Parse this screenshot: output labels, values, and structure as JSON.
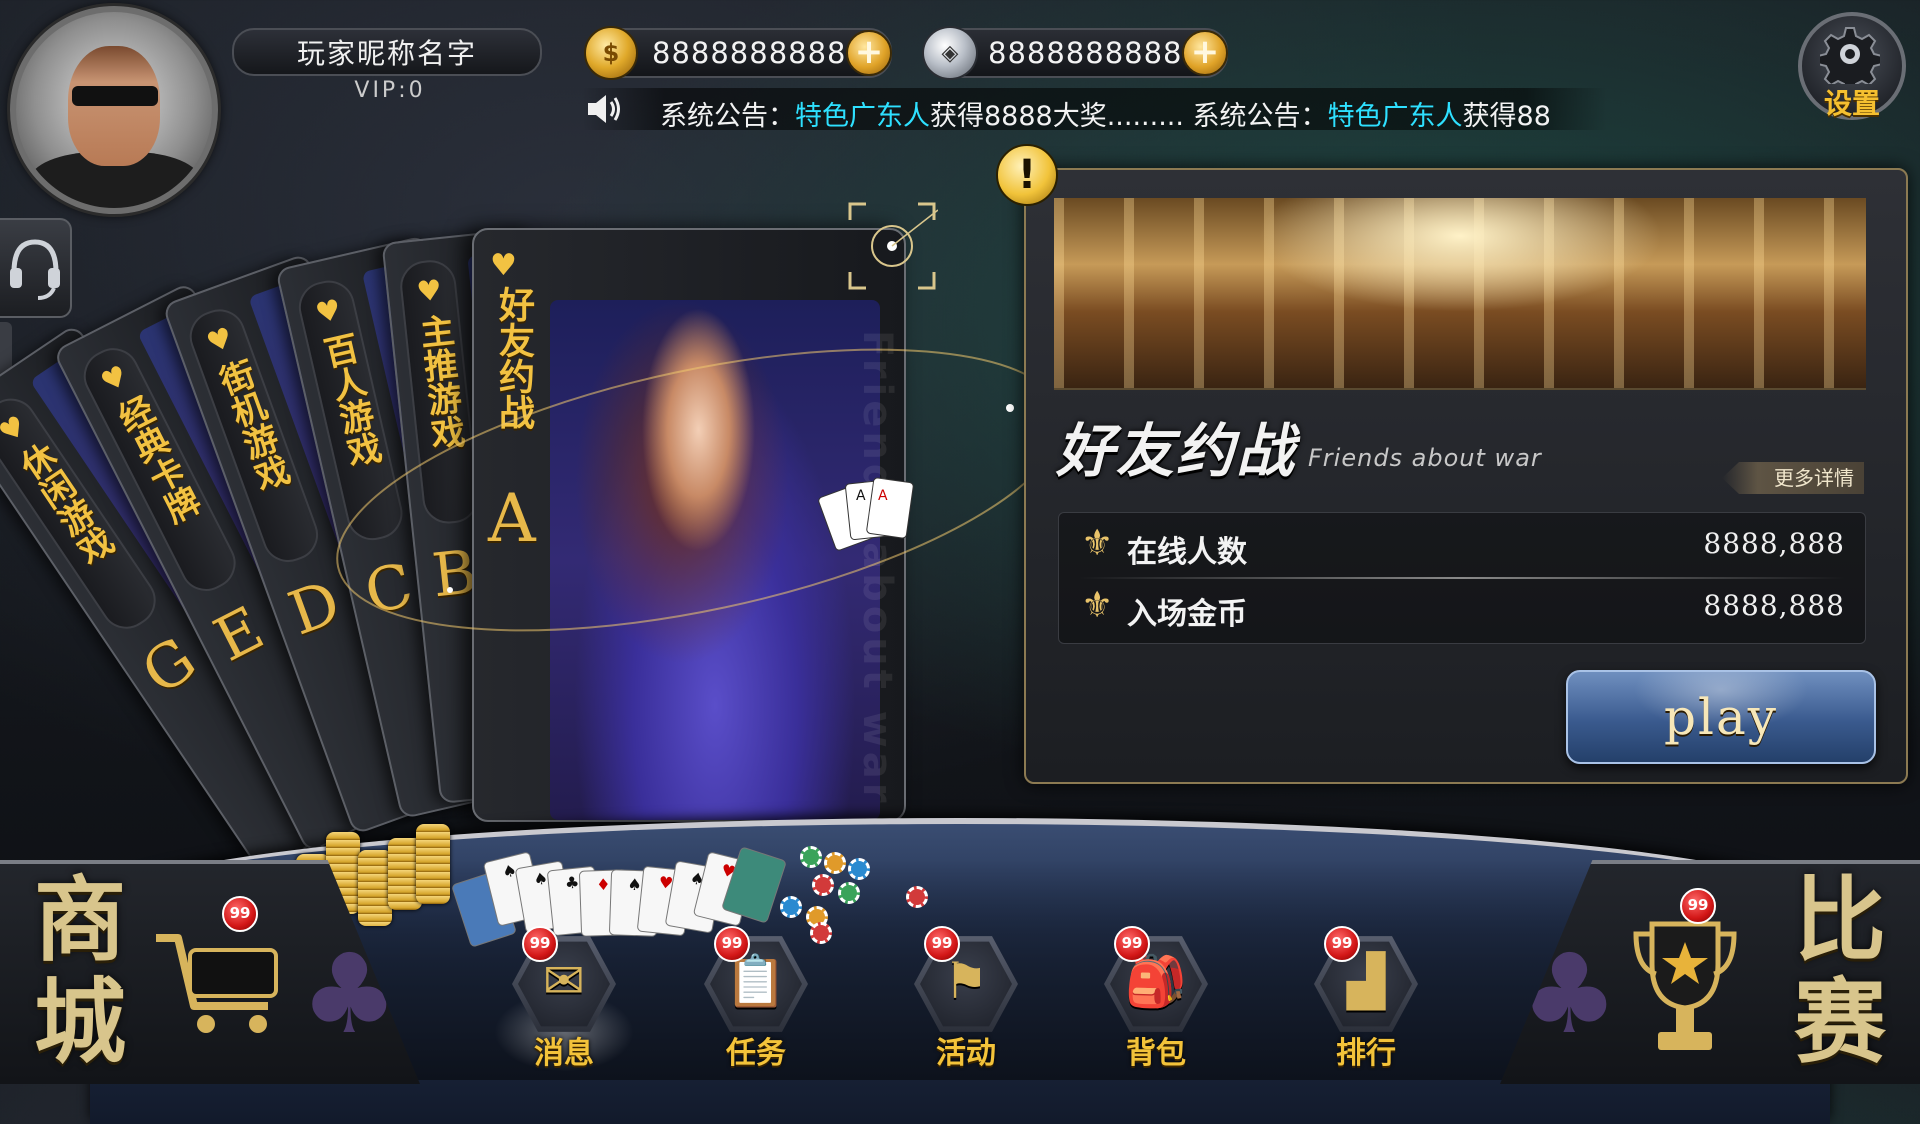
{
  "player": {
    "nickname": "玩家昵称名字",
    "vip": "VIP:0",
    "gold": "8888888888",
    "diamond": "8888888888"
  },
  "notice": {
    "prefix1": "系统公告：",
    "name1": "特色广东人",
    "msg1": "获得8888大奖.........",
    "prefix2": " 系统公告：",
    "name2": "特色广东人",
    "msg2": "获得88"
  },
  "settings": {
    "label": "设置"
  },
  "game_categories": [
    {
      "title": "休闲游戏",
      "letter": "G"
    },
    {
      "title": "经典卡牌",
      "letter": "E"
    },
    {
      "title": "街机游戏",
      "letter": "D"
    },
    {
      "title": "百人游戏",
      "letter": "C"
    },
    {
      "title": "主推游戏",
      "letter": "B"
    },
    {
      "title": "好友约战",
      "letter": "A"
    }
  ],
  "front_card": {
    "title": "好友约战",
    "letter": "A",
    "ghost_text": "Friends about war"
  },
  "panel": {
    "title": "好友约战",
    "subtitle": "Friends about war",
    "more": "更多详情",
    "stats": [
      {
        "label": "在线人数",
        "value": "8888,888"
      },
      {
        "label": "入场金币",
        "value": "8888,888"
      }
    ],
    "play_label": "play"
  },
  "shop": {
    "label_top": "商",
    "label_bottom": "城",
    "badge": "99"
  },
  "match": {
    "label_top": "比",
    "label_bottom": "赛",
    "badge": "99"
  },
  "nav": [
    {
      "label": "消息",
      "badge": "99",
      "icon": "envelope-icon"
    },
    {
      "label": "任务",
      "badge": "99",
      "icon": "clipboard-icon"
    },
    {
      "label": "活动",
      "badge": "99",
      "icon": "flag-icon"
    },
    {
      "label": "背包",
      "badge": "99",
      "icon": "backpack-icon"
    },
    {
      "label": "排行",
      "badge": "99",
      "icon": "podium-icon"
    }
  ],
  "colors": {
    "accent_gold": "#f2c242",
    "notice_highlight": "#2ee0ff",
    "badge_red": "#d21616"
  }
}
